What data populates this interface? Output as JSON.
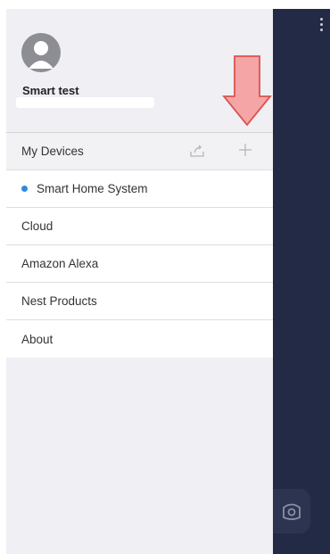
{
  "profile": {
    "username": "Smart test"
  },
  "menu": {
    "header": "My Devices",
    "items": [
      {
        "label": "Smart Home System",
        "active": true
      },
      {
        "label": "Cloud"
      },
      {
        "label": "Amazon Alexa"
      },
      {
        "label": "Nest Products"
      },
      {
        "label": "About"
      }
    ]
  },
  "icons": [
    "avatar-icon",
    "share-icon",
    "plus-icon",
    "kebab-menu-icon",
    "camera-icon",
    "arrow-down-icon"
  ],
  "colors": {
    "accent": "#2e8bde",
    "panel": "#232a45",
    "arrow": "#f5a5a5"
  }
}
